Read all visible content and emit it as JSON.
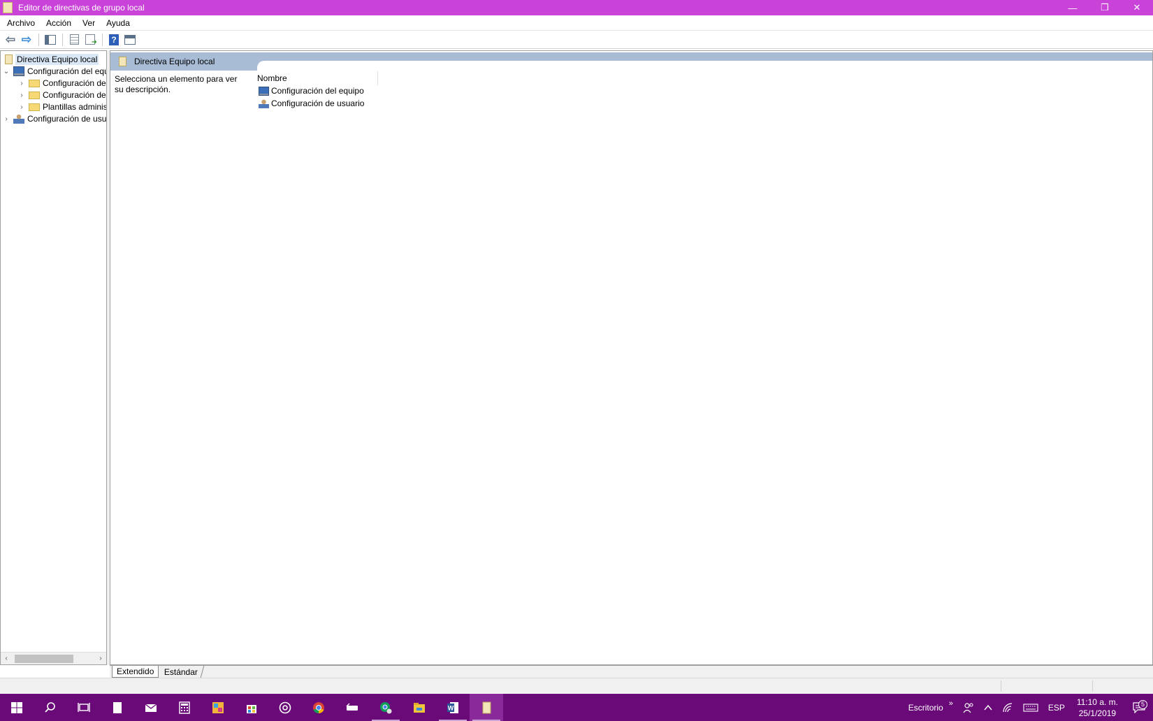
{
  "window": {
    "title": "Editor de directivas de grupo local",
    "controls": {
      "minimize": "—",
      "restore": "❐",
      "close": "✕"
    },
    "title_bar_color": "#c943d8"
  },
  "menu": [
    "Archivo",
    "Acción",
    "Ver",
    "Ayuda"
  ],
  "toolbar": {
    "buttons": [
      "back-arrow-icon",
      "forward-arrow-icon",
      "show-hide-tree-icon",
      "properties-list-icon",
      "export-list-icon",
      "help-icon",
      "show-hide-action-pane-icon"
    ],
    "back_glyph": "⇦",
    "forward_glyph": "⇨",
    "help_glyph": "?"
  },
  "tree": {
    "root": "Directiva Equipo local",
    "items": [
      {
        "label": "Configuración del equipo",
        "expander": "⌄",
        "icon": "computer-icon"
      },
      {
        "label": "Configuración de software",
        "expander": "›",
        "icon": "folder-icon"
      },
      {
        "label": "Configuración de Windows",
        "expander": "›",
        "icon": "folder-icon"
      },
      {
        "label": "Plantillas administrativas",
        "expander": "›",
        "icon": "folder-icon"
      },
      {
        "label": "Configuración de usuario",
        "expander": "›",
        "icon": "user-icon"
      }
    ],
    "scroll_left": "‹",
    "scroll_right": "›"
  },
  "main": {
    "header_title": "Directiva Equipo local",
    "description": "Selecciona un elemento para ver su descripción.",
    "column_header": "Nombre",
    "rows": [
      {
        "label": "Configuración del equipo",
        "icon": "computer-icon"
      },
      {
        "label": "Configuración de usuario",
        "icon": "user-icon"
      }
    ],
    "header_color": "#a8bcd6"
  },
  "bottom_tabs": [
    "Extendido",
    "Estándar"
  ],
  "taskbar": {
    "color": "#6a0a78",
    "apps": [
      "windows-start-icon",
      "search-icon",
      "task-view-icon",
      "notepad-icon",
      "mail-icon",
      "calculator-icon",
      "paint-icon",
      "store-icon",
      "groove-icon",
      "chrome-icon",
      "keyboard-icon",
      "chrome-profile-icon",
      "file-explorer-icon",
      "word-icon",
      "policy-editor-icon"
    ],
    "desktop_label": "Escritorio",
    "desktop_chevron": "»",
    "language": "ESP",
    "time": "11:10 a. m.",
    "date": "25/1/2019",
    "notification_count": "5"
  }
}
